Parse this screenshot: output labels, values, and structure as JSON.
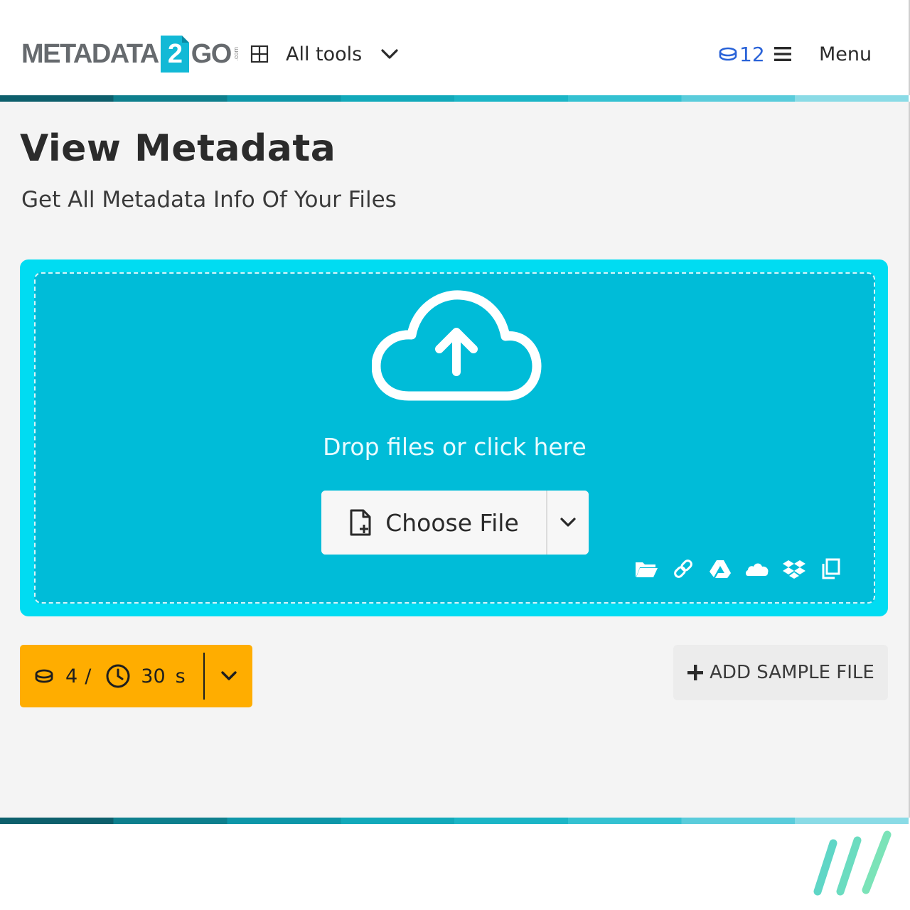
{
  "header": {
    "logo": {
      "left": "METADATA",
      "badge": "2",
      "right": "GO",
      "suffix": ".com"
    },
    "all_tools_label": "All tools",
    "credits": "12",
    "menu_label": "Menu"
  },
  "page": {
    "title": "View Metadata",
    "subtitle": "Get All Metadata Info Of Your Files"
  },
  "upload": {
    "drop_text": "Drop files or click here",
    "choose_label": "Choose File",
    "sources": [
      "folder-icon",
      "link-icon",
      "google-drive-icon",
      "onedrive-icon",
      "dropbox-icon",
      "clipboard-icon"
    ]
  },
  "cost": {
    "credits": "4",
    "separator": "/",
    "time": "30",
    "unit": "s"
  },
  "sample": {
    "label": "ADD SAMPLE FILE"
  },
  "colors": {
    "accent_cyan": "#00bcd8",
    "dropzone_border": "#00dcf2",
    "cost_orange": "#ffad00",
    "credits_blue": "#2a63d8"
  }
}
